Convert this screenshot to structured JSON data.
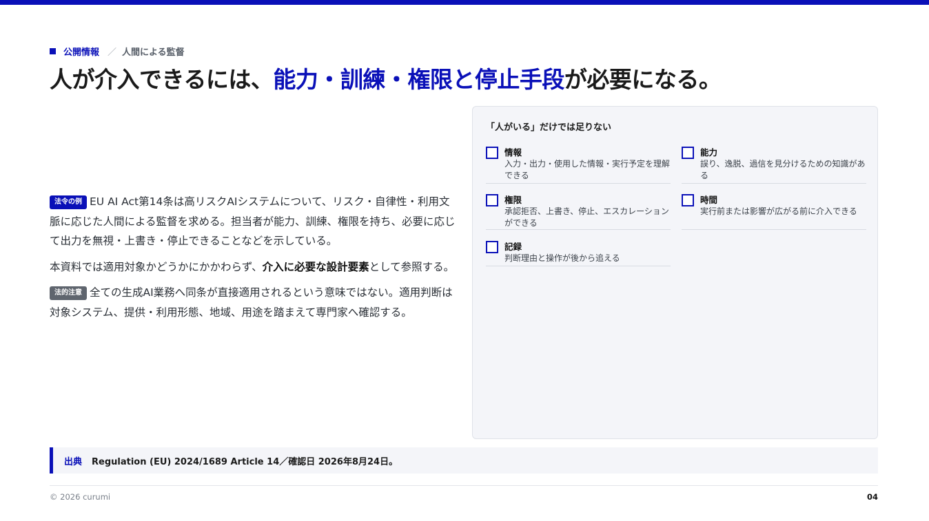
{
  "breadcrumb": {
    "category": "公開情報",
    "separator": "／",
    "section": "人間による監督"
  },
  "title": {
    "part1": "人が介入できるには、",
    "highlight": "能力・訓練・権限と停止手段",
    "part2": "が必要になる。"
  },
  "body": {
    "p1_tag": "法令の例",
    "p1_text": "EU AI Act第14条は高リスクAIシステムについて、リスク・自律性・利用文脈に応じた人間による監督を求める。担当者が能力、訓練、権限を持ち、必要に応じて出力を無視・上書き・停止できることなどを示している。",
    "p2_pre": "本資料では適用対象かどうかにかかわらず、",
    "p2_bold": "介入に必要な設計要素",
    "p2_post": "として参照する。",
    "p3_tag": "法的注意",
    "p3_text": "全ての生成AI業務へ同条が直接適用されるという意味ではない。適用判断は対象システム、提供・利用形態、地域、用途を踏まえて専門家へ確認する。"
  },
  "panel": {
    "title": "「人がいる」だけでは足りない",
    "items": [
      {
        "title": "情報",
        "desc": "入力・出力・使用した情報・実行予定を理解できる"
      },
      {
        "title": "能力",
        "desc": "誤り、逸脱、過信を見分けるための知識がある"
      },
      {
        "title": "権限",
        "desc": "承認拒否、上書き、停止、エスカレーションができる"
      },
      {
        "title": "時間",
        "desc": "実行前または影響が広がる前に介入できる"
      },
      {
        "title": "記録",
        "desc": "判断理由と操作が後から追える"
      }
    ]
  },
  "source": {
    "label": "出典",
    "text": "Regulation (EU) 2024/1689 Article 14／確認日 2026年8月24日。"
  },
  "footer": {
    "copyright": "© 2026 curumi",
    "page": "04"
  },
  "colors": {
    "accent": "#0a10b8",
    "panel_bg": "#f4f5f9",
    "note_tag": "#5f656e"
  }
}
